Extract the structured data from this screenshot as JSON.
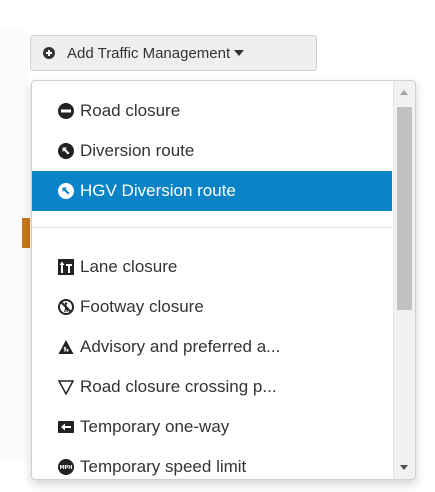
{
  "trigger": {
    "label": "Add Traffic Management"
  },
  "menu": {
    "items": [
      {
        "label": "Road closure",
        "icon": "road-closure-icon"
      },
      {
        "label": "Diversion route",
        "icon": "diversion-route-icon"
      },
      {
        "label": "HGV Diversion route",
        "icon": "hgv-diversion-route-icon",
        "active": true
      },
      {
        "label": "Lane closure",
        "icon": "lane-closure-icon"
      },
      {
        "label": "Footway closure",
        "icon": "footway-closure-icon"
      },
      {
        "label": "Advisory and preferred a...",
        "icon": "advisory-icon"
      },
      {
        "label": "Road closure crossing p...",
        "icon": "crossing-point-icon"
      },
      {
        "label": "Temporary one-way",
        "icon": "one-way-icon"
      },
      {
        "label": "Temporary speed limit",
        "icon": "speed-limit-icon"
      }
    ],
    "icon_badge_text": "MPH"
  },
  "colors": {
    "active_bg": "#0a83c7",
    "accent": "#c9771a",
    "text": "#333333"
  }
}
